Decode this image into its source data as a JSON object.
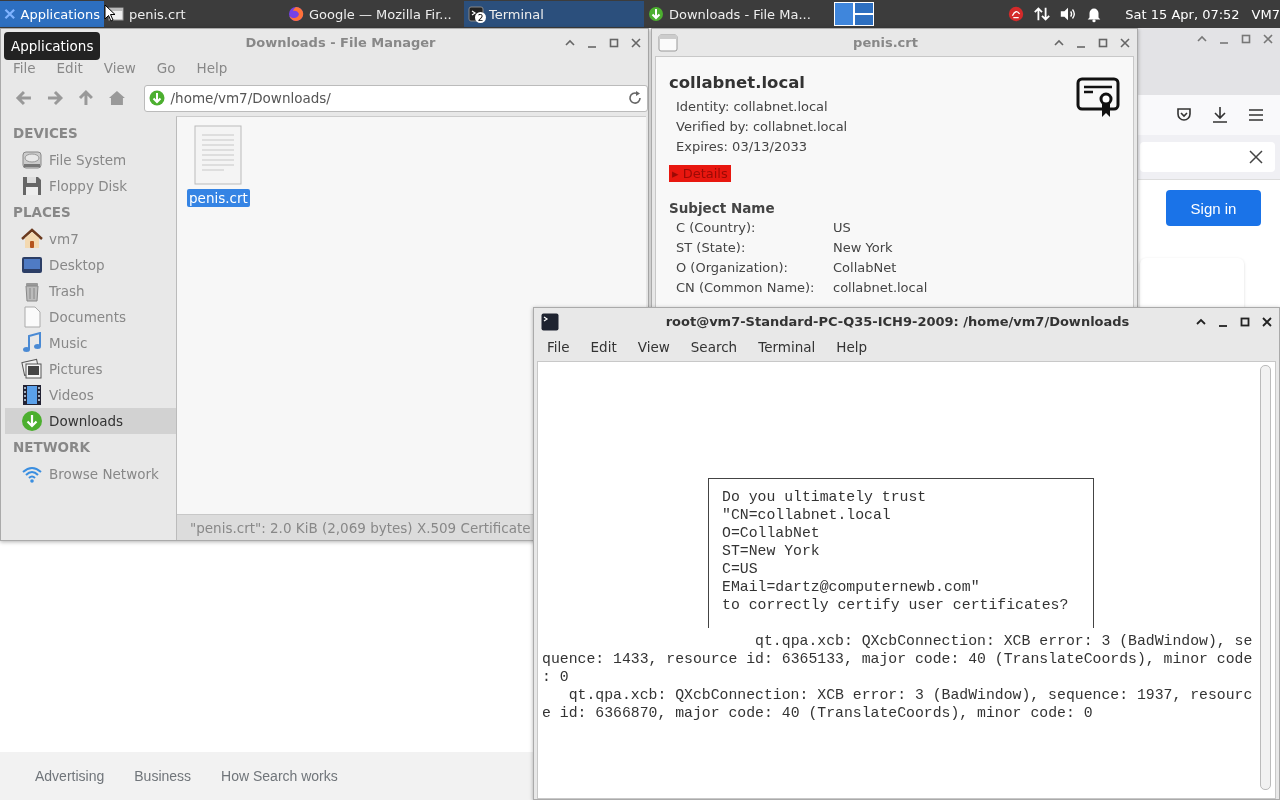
{
  "taskbar": {
    "launcher": {
      "label": "Applications",
      "selected": true
    },
    "tasks": [
      {
        "label": "penis.crt",
        "kind": "window",
        "selected": false
      },
      {
        "label": "Google — Mozilla Fir...",
        "kind": "browser",
        "selected": false
      },
      {
        "label": "Terminal",
        "kind": "terminal",
        "selected": true,
        "badge": "2"
      },
      {
        "label": "Downloads - File Ma...",
        "kind": "downloads",
        "selected": false
      }
    ],
    "clock": "Sat 15 Apr, 07:52",
    "user": "VM7"
  },
  "tooltip": "Applications",
  "browser": {
    "sign_in": "Sign in",
    "footer_links": [
      "Advertising",
      "Business",
      "How Search works"
    ]
  },
  "file_manager": {
    "title": "Downloads - File Manager",
    "menu": [
      "File",
      "Edit",
      "View",
      "Go",
      "Help"
    ],
    "location": "/home/vm7/Downloads/",
    "sidebar": [
      {
        "title": "DEVICES",
        "items": [
          {
            "label": "File System",
            "kind": "drive",
            "selected": false
          },
          {
            "label": "Floppy Disk",
            "kind": "floppy",
            "selected": false
          }
        ]
      },
      {
        "title": "PLACES",
        "items": [
          {
            "label": "vm7",
            "kind": "home",
            "selected": false
          },
          {
            "label": "Desktop",
            "kind": "desktop",
            "selected": false
          },
          {
            "label": "Trash",
            "kind": "trash",
            "selected": false
          },
          {
            "label": "Documents",
            "kind": "document",
            "selected": false
          },
          {
            "label": "Music",
            "kind": "music",
            "selected": false
          },
          {
            "label": "Pictures",
            "kind": "pictures",
            "selected": false
          },
          {
            "label": "Videos",
            "kind": "videos",
            "selected": false
          },
          {
            "label": "Downloads",
            "kind": "downloads",
            "selected": true
          }
        ]
      },
      {
        "title": "NETWORK",
        "items": [
          {
            "label": "Browse Network",
            "kind": "network",
            "selected": false
          }
        ]
      }
    ],
    "files": [
      {
        "name": "penis.crt",
        "selected": true
      }
    ],
    "status": "\"penis.crt\": 2.0 KiB (2,069 bytes) X.509 Certificate"
  },
  "certificate": {
    "title": "penis.crt",
    "name": "collabnet.local",
    "info": [
      "Identity: collabnet.local",
      "Verified by: collabnet.local",
      "Expires: 03/13/2033"
    ],
    "details": "▸ Details",
    "section": "Subject Name",
    "rows": [
      {
        "label": "C (Country):",
        "value": "US"
      },
      {
        "label": "ST (State):",
        "value": "New York"
      },
      {
        "label": "O (Organization):",
        "value": "CollabNet"
      },
      {
        "label": "CN (Common Name):",
        "value": "collabnet.local"
      }
    ]
  },
  "terminal": {
    "title": "root@vm7-Standard-PC-Q35-ICH9-2009: /home/vm7/Downloads",
    "menu": [
      "File",
      "Edit",
      "View",
      "Search",
      "Terminal",
      "Help"
    ],
    "dialog": [
      "Do you ultimately trust",
      "\"CN=collabnet.local",
      "O=CollabNet",
      "ST=New York",
      "C=US",
      "EMail=dartz@computernewb.com\"",
      "to correctly certify user certificates?"
    ],
    "output": [
      "qt.qpa.xcb: QXcbConnection: XCB error: 3 (BadWindow), se",
      "quence: 1433, resource id: 6365133, major code: 40 (TranslateCoords), minor code",
      ": 0",
      "qt.qpa.xcb: QXcbConnection: XCB error: 3 (BadWindow), sequence: 1937, resourc",
      "e id: 6366870, major code: 40 (TranslateCoords), minor code: 0"
    ]
  }
}
